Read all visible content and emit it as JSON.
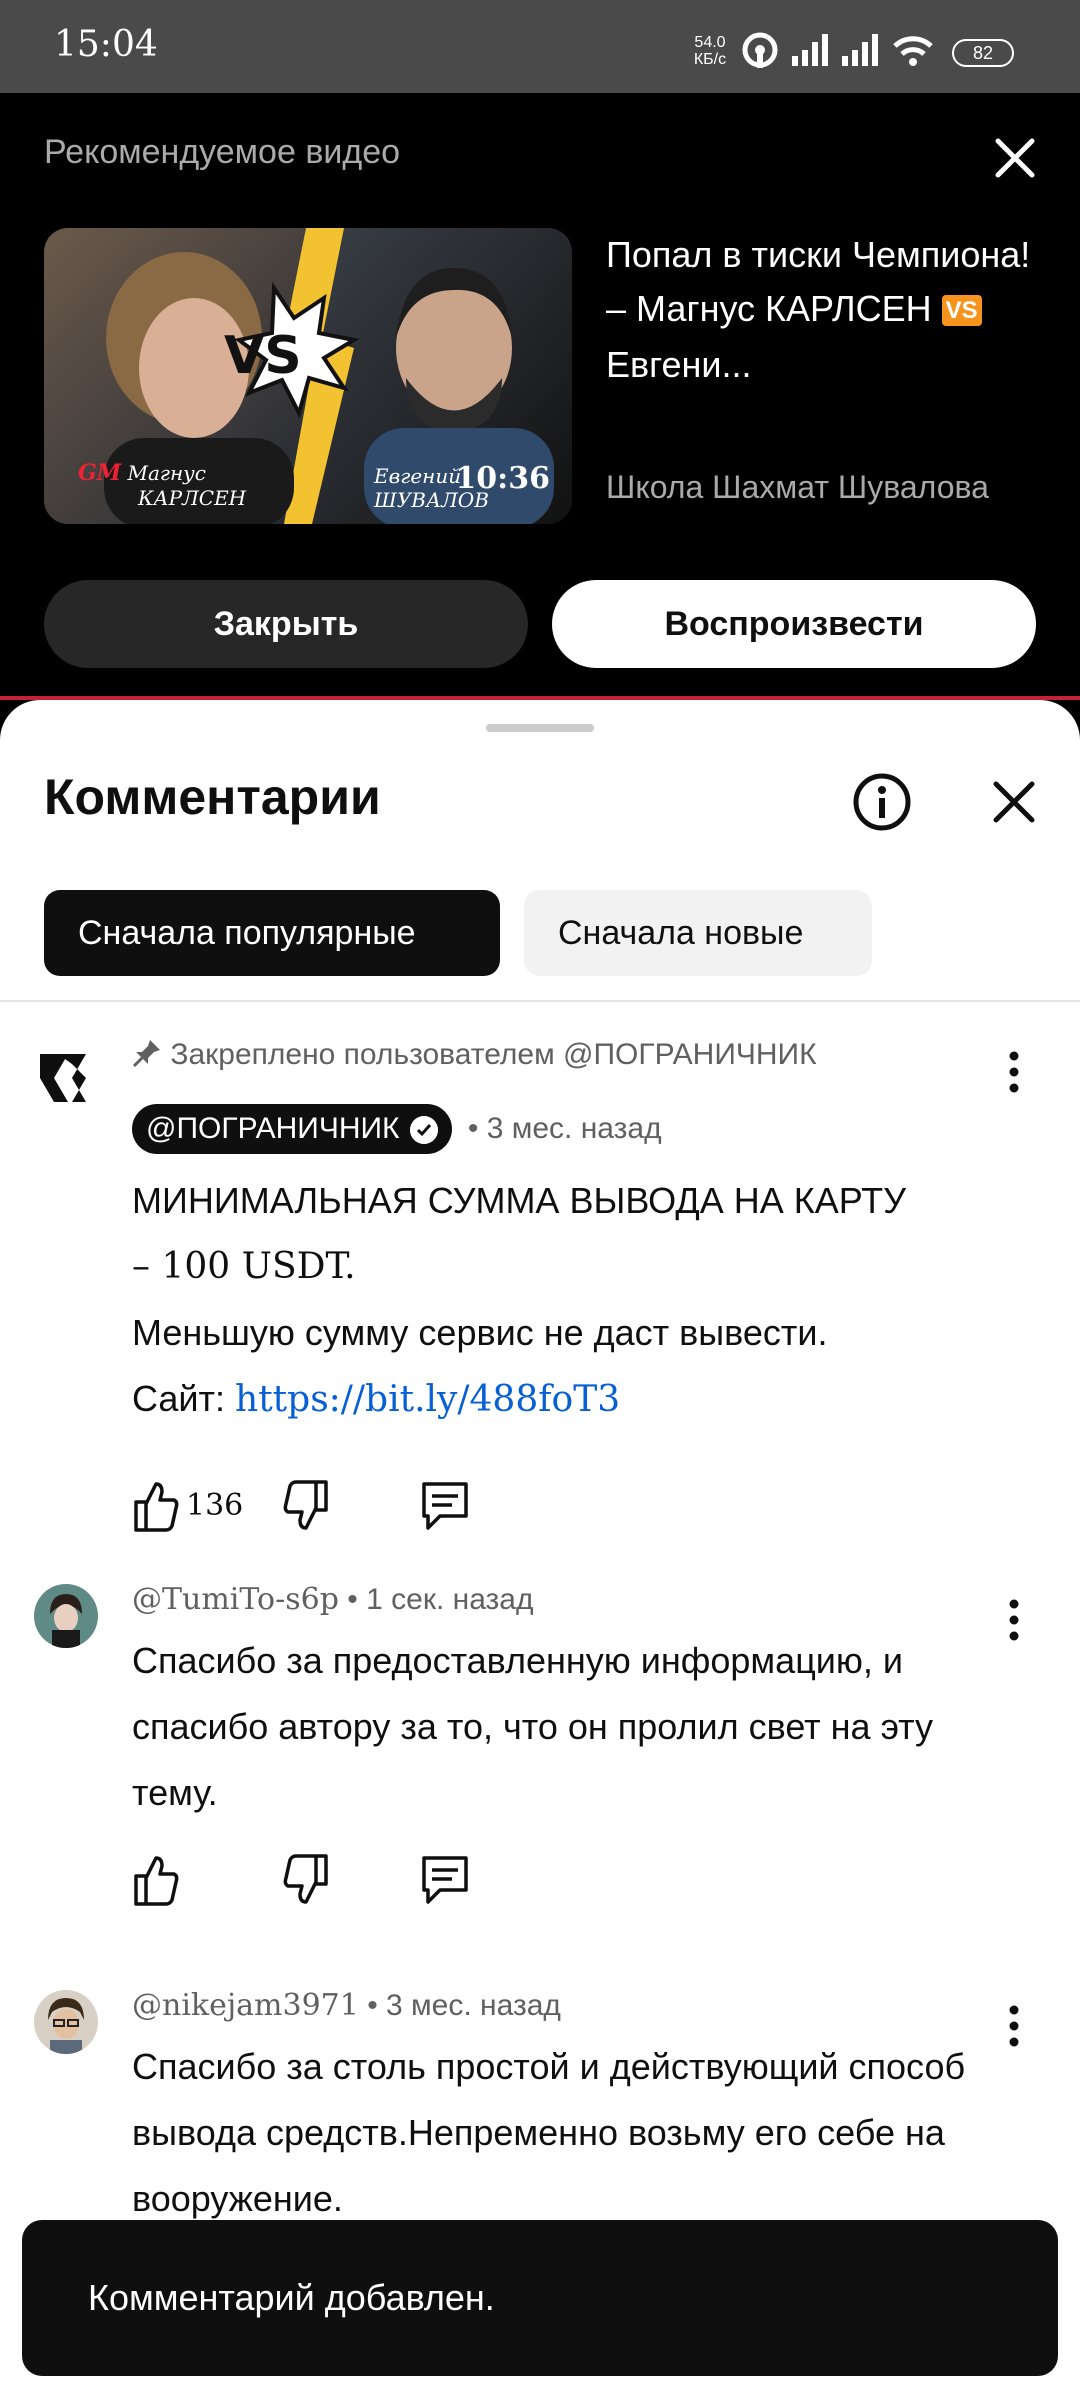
{
  "status_bar": {
    "time": "15:04",
    "net_speed_value": "54.0",
    "net_speed_unit": "КБ/с",
    "battery": "82",
    "icons": [
      "hotspot-icon",
      "signal-icon",
      "signal-icon",
      "wifi-icon",
      "battery-icon"
    ]
  },
  "recommended": {
    "header": "Рекомендуемое видео",
    "video_title": "Попал в тиски Чемпиона! – Магнус КАРЛСЕН",
    "video_title_vs": "VS",
    "video_title_end": "Евгени...",
    "channel": "Школа Шахмат Шувалова",
    "duration": "10:36",
    "thumb_left_caption_gm": "GM",
    "thumb_left_caption_first": "Магнус",
    "thumb_left_caption_last": "КАРЛСЕН",
    "thumb_vs": "VS",
    "thumb_right_caption_first": "Евгений",
    "thumb_right_caption_last": "ШУВАЛОВ",
    "close_button": "Закрыть",
    "play_button": "Воспроизвести"
  },
  "comments_panel": {
    "title": "Комментарии",
    "sort_chips": [
      {
        "label": "Сначала популярные",
        "active": true
      },
      {
        "label": "Сначала новые",
        "active": false
      }
    ],
    "comments": [
      {
        "pinned_text": "Закреплено пользователем @ПОГРАНИЧНИК",
        "author": "@ПОГРАНИЧНИК",
        "verified": true,
        "time": "• 3 мес. назад",
        "line1": "МИНИМАЛЬНАЯ СУММА ВЫВОДА НА КАРТУ",
        "line2": "– 100 USDT.",
        "line3": "Меньшую сумму сервис не даст вывести.",
        "line4_label": "Сайт: ",
        "link": "https://bit.ly/488foT3",
        "likes": "136"
      },
      {
        "author": "@TumiTo-s6p",
        "time": "• 1 сек. назад",
        "text": "Спасибо за предоставленную информацию, и спасибо автору за то, что он пролил свет на эту тему.",
        "likes": ""
      },
      {
        "author": "@nikejam3971",
        "time": "• 3 мес. назад",
        "text": "Спасибо за столь простой и действующий способ вывода средств.Непременно возьму его себе на вооружение."
      }
    ]
  },
  "toast": {
    "text": "Комментарий добавлен."
  },
  "colors": {
    "accent_red": "#c3223b",
    "link_blue": "#065fd4",
    "vs_orange": "#f7941d"
  }
}
